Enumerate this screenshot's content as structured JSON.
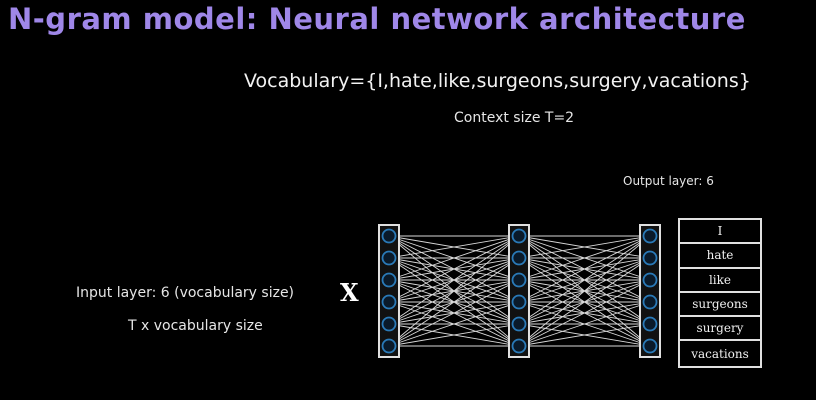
{
  "title": "N-gram model: Neural network architecture",
  "vocabulary_text": "Vocabulary={I,hate,like,surgeons,surgery,vacations}",
  "context_text": "Context size T=2",
  "output_label": "Output layer: 6",
  "input_label": "Input layer: 6 (vocabulary size)",
  "input_size_text": "T x vocabulary size",
  "x_symbol": "X",
  "network": {
    "layers": [
      6,
      6,
      6
    ],
    "edge_color": "#d8d8d8",
    "node_color": "#2a7ab8",
    "node_fill": "#0a1a2a"
  },
  "output_words": [
    "I",
    "hate",
    "like",
    "surgeons",
    "surgery",
    "vacations"
  ]
}
